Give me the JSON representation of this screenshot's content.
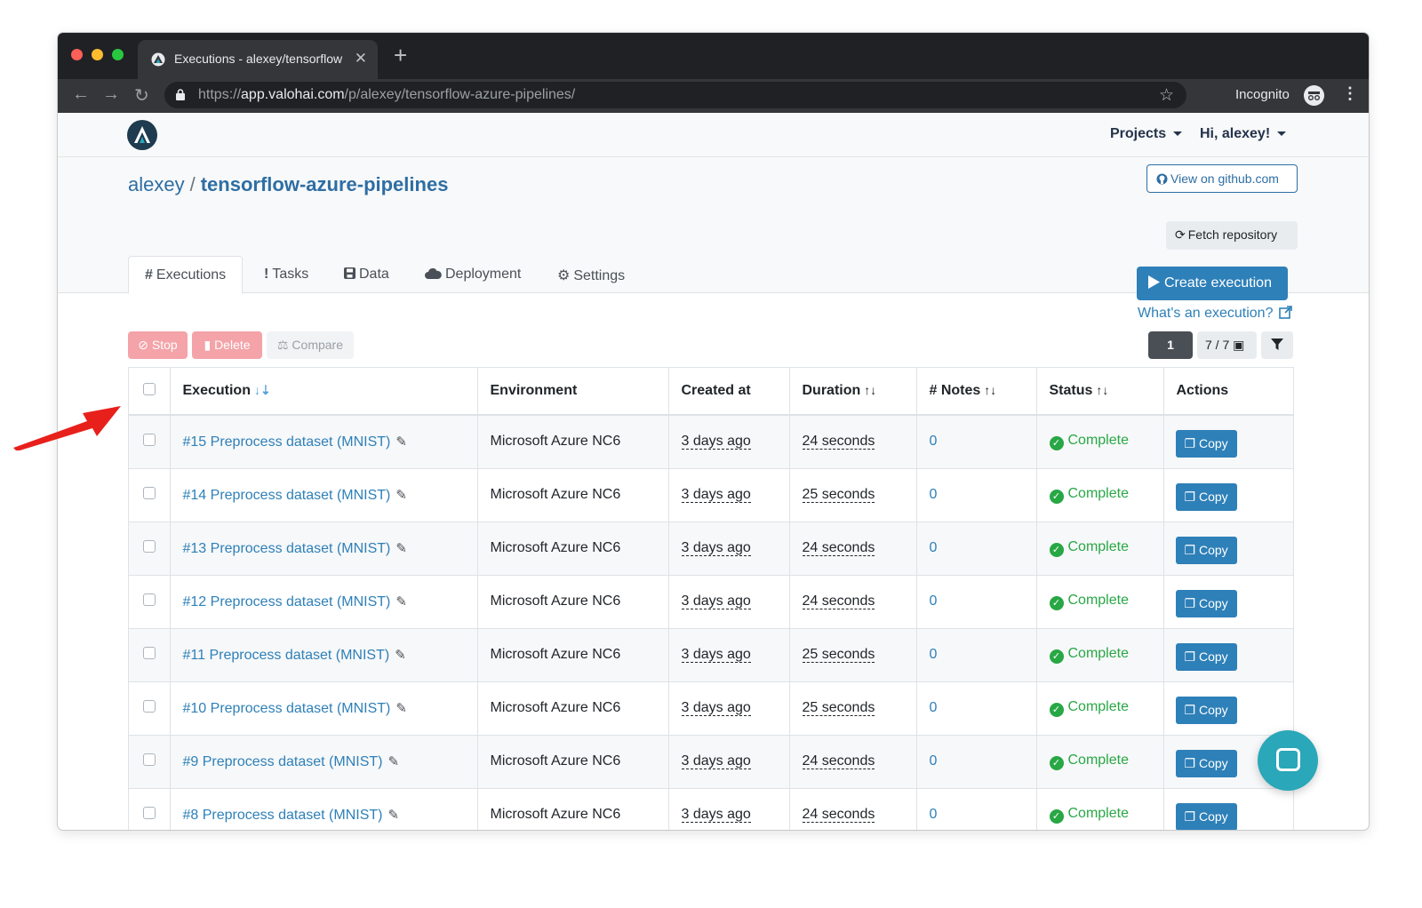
{
  "browser": {
    "tab_title": "Executions - alexey/tensorflow",
    "url_scheme": "https://",
    "url_host": "app.valohai.com",
    "url_path": "/p/alexey/tensorflow-azure-pipelines/",
    "incognito_label": "Incognito"
  },
  "header": {
    "projects_label": "Projects",
    "user_label": "Hi, alexey!"
  },
  "project": {
    "owner": "alexey",
    "separator": "/",
    "name": "tensorflow-azure-pipelines",
    "github_button": "View on github.com",
    "fetch_button": "Fetch repository"
  },
  "tabs": [
    {
      "icon": "#",
      "label": "Executions"
    },
    {
      "icon": "!",
      "label": "Tasks"
    },
    {
      "icon": "floppy",
      "label": "Data"
    },
    {
      "icon": "cloud",
      "label": "Deployment"
    },
    {
      "icon": "gear",
      "label": "Settings"
    }
  ],
  "actions": {
    "create_label": "Create execution",
    "what_link": "What's an execution?",
    "stop_label": "Stop",
    "delete_label": "Delete",
    "compare_label": "Compare",
    "page_number": "1",
    "columns_label": "7 / 7"
  },
  "table": {
    "headers": [
      "Execution",
      "Environment",
      "Created at",
      "Duration",
      "# Notes",
      "Status",
      "Actions"
    ],
    "rows": [
      {
        "execution": "#15 Preprocess dataset (MNIST)",
        "environment": "Microsoft Azure NC6",
        "created": "3 days ago",
        "duration": "24 seconds",
        "notes": "0",
        "status": "Complete",
        "action": "Copy"
      },
      {
        "execution": "#14 Preprocess dataset (MNIST)",
        "environment": "Microsoft Azure NC6",
        "created": "3 days ago",
        "duration": "25 seconds",
        "notes": "0",
        "status": "Complete",
        "action": "Copy"
      },
      {
        "execution": "#13 Preprocess dataset (MNIST)",
        "environment": "Microsoft Azure NC6",
        "created": "3 days ago",
        "duration": "24 seconds",
        "notes": "0",
        "status": "Complete",
        "action": "Copy"
      },
      {
        "execution": "#12 Preprocess dataset (MNIST)",
        "environment": "Microsoft Azure NC6",
        "created": "3 days ago",
        "duration": "24 seconds",
        "notes": "0",
        "status": "Complete",
        "action": "Copy"
      },
      {
        "execution": "#11 Preprocess dataset (MNIST)",
        "environment": "Microsoft Azure NC6",
        "created": "3 days ago",
        "duration": "25 seconds",
        "notes": "0",
        "status": "Complete",
        "action": "Copy"
      },
      {
        "execution": "#10 Preprocess dataset (MNIST)",
        "environment": "Microsoft Azure NC6",
        "created": "3 days ago",
        "duration": "25 seconds",
        "notes": "0",
        "status": "Complete",
        "action": "Copy"
      },
      {
        "execution": "#9 Preprocess dataset (MNIST)",
        "environment": "Microsoft Azure NC6",
        "created": "3 days ago",
        "duration": "24 seconds",
        "notes": "0",
        "status": "Complete",
        "action": "Copy"
      },
      {
        "execution": "#8 Preprocess dataset (MNIST)",
        "environment": "Microsoft Azure NC6",
        "created": "3 days ago",
        "duration": "24 seconds",
        "notes": "0",
        "status": "Complete",
        "action": "Copy"
      }
    ]
  },
  "colors": {
    "brand_blue": "#2e80b8",
    "success_green": "#28a745",
    "danger_light": "#f4a3a8",
    "annotation_arrow": "#e8201c"
  }
}
